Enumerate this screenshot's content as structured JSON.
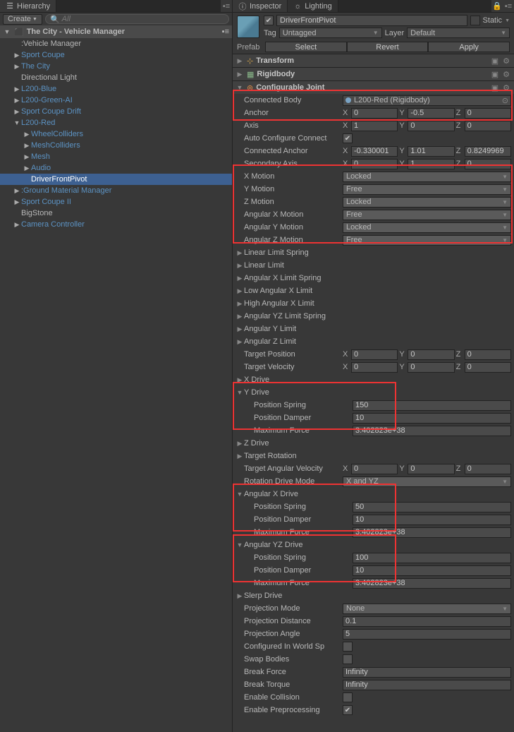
{
  "hierarchy": {
    "tab": "Hierarchy",
    "create": "Create",
    "search_placeholder": "All",
    "scene": "The City - Vehicle Manager",
    "items": [
      {
        "label": ":Vehicle Manager",
        "indent": 1,
        "fold": "",
        "blue": false
      },
      {
        "label": "Sport Coupe",
        "indent": 1,
        "fold": "▶",
        "blue": true
      },
      {
        "label": "The City",
        "indent": 1,
        "fold": "▶",
        "blue": true
      },
      {
        "label": "Directional Light",
        "indent": 1,
        "fold": "",
        "blue": false
      },
      {
        "label": "L200-Blue",
        "indent": 1,
        "fold": "▶",
        "blue": true
      },
      {
        "label": "L200-Green-AI",
        "indent": 1,
        "fold": "▶",
        "blue": true
      },
      {
        "label": "Sport Coupe Drift",
        "indent": 1,
        "fold": "▶",
        "blue": true
      },
      {
        "label": "L200-Red",
        "indent": 1,
        "fold": "▼",
        "blue": true
      },
      {
        "label": "WheelColliders",
        "indent": 2,
        "fold": "▶",
        "blue": true
      },
      {
        "label": "MeshColliders",
        "indent": 2,
        "fold": "▶",
        "blue": true
      },
      {
        "label": "Mesh",
        "indent": 2,
        "fold": "▶",
        "blue": true
      },
      {
        "label": "Audio",
        "indent": 2,
        "fold": "▶",
        "blue": true
      },
      {
        "label": "DriverFrontPivot",
        "indent": 2,
        "fold": "",
        "blue": true,
        "sel": true
      },
      {
        "label": ":Ground Material Manager",
        "indent": 1,
        "fold": "▶",
        "blue": true
      },
      {
        "label": "Sport Coupe II",
        "indent": 1,
        "fold": "▶",
        "blue": true
      },
      {
        "label": "BigStone",
        "indent": 1,
        "fold": "",
        "blue": false
      },
      {
        "label": "Camera Controller",
        "indent": 1,
        "fold": "▶",
        "blue": true
      }
    ]
  },
  "inspector": {
    "tabs": {
      "inspector": "Inspector",
      "lighting": "Lighting"
    },
    "name": "DriverFrontPivot",
    "static": "Static",
    "tag_label": "Tag",
    "tag": "Untagged",
    "layer_label": "Layer",
    "layer": "Default",
    "prefab_label": "Prefab",
    "prefab": {
      "select": "Select",
      "revert": "Revert",
      "apply": "Apply"
    },
    "components": {
      "transform": "Transform",
      "rigidbody": "Rigidbody",
      "cj": "Configurable Joint"
    },
    "cj": {
      "connected_body": {
        "label": "Connected Body",
        "value": "L200-Red (Rigidbody)"
      },
      "anchor": {
        "label": "Anchor",
        "x": "0",
        "y": "-0.5",
        "z": "0"
      },
      "axis": {
        "label": "Axis",
        "x": "1",
        "y": "0",
        "z": "0"
      },
      "auto_configure": {
        "label": "Auto Configure Connect",
        "checked": true
      },
      "connected_anchor": {
        "label": "Connected Anchor",
        "x": "-0.330001",
        "y": "1.01",
        "z": "0.8249969"
      },
      "secondary_axis": {
        "label": "Secondary Axis",
        "x": "0",
        "y": "1",
        "z": "0"
      },
      "x_motion": {
        "label": "X Motion",
        "value": "Locked"
      },
      "y_motion": {
        "label": "Y Motion",
        "value": "Free"
      },
      "z_motion": {
        "label": "Z Motion",
        "value": "Locked"
      },
      "ax_motion": {
        "label": "Angular X Motion",
        "value": "Free"
      },
      "ay_motion": {
        "label": "Angular Y Motion",
        "value": "Locked"
      },
      "az_motion": {
        "label": "Angular Z Motion",
        "value": "Free"
      },
      "linear_limit_spring": "Linear Limit Spring",
      "linear_limit": "Linear Limit",
      "ax_limit_spring": "Angular X Limit Spring",
      "low_ax_limit": "Low Angular X Limit",
      "high_ax_limit": "High Angular X Limit",
      "ayz_limit_spring": "Angular YZ Limit Spring",
      "ay_limit": "Angular Y Limit",
      "az_limit": "Angular Z Limit",
      "target_position": {
        "label": "Target Position",
        "x": "0",
        "y": "0",
        "z": "0"
      },
      "target_velocity": {
        "label": "Target Velocity",
        "x": "0",
        "y": "0",
        "z": "0"
      },
      "x_drive": "X Drive",
      "y_drive": {
        "label": "Y Drive",
        "spring": "150",
        "damper": "10",
        "force": "3.402823e+38"
      },
      "z_drive": "Z Drive",
      "target_rotation": "Target Rotation",
      "target_angular_velocity": {
        "label": "Target Angular Velocity",
        "x": "0",
        "y": "0",
        "z": "0"
      },
      "rotation_drive_mode": {
        "label": "Rotation Drive Mode",
        "value": "X and YZ"
      },
      "ax_drive": {
        "label": "Angular X Drive",
        "spring": "50",
        "damper": "10",
        "force": "3.402823e+38"
      },
      "ayz_drive": {
        "label": "Angular YZ Drive",
        "spring": "100",
        "damper": "10",
        "force": "3.402823e+38"
      },
      "slerp_drive": "Slerp Drive",
      "projection_mode": {
        "label": "Projection Mode",
        "value": "None"
      },
      "projection_distance": {
        "label": "Projection Distance",
        "value": "0.1"
      },
      "projection_angle": {
        "label": "Projection Angle",
        "value": "5"
      },
      "configured_in_world": {
        "label": "Configured In World Sp"
      },
      "swap_bodies": {
        "label": "Swap Bodies"
      },
      "break_force": {
        "label": "Break Force",
        "value": "Infinity"
      },
      "break_torque": {
        "label": "Break Torque",
        "value": "Infinity"
      },
      "enable_collision": {
        "label": "Enable Collision"
      },
      "enable_preprocessing": {
        "label": "Enable Preprocessing",
        "checked": true
      },
      "drive_sub": {
        "spring": "Position Spring",
        "damper": "Position Damper",
        "force": "Maximum Force"
      }
    }
  }
}
